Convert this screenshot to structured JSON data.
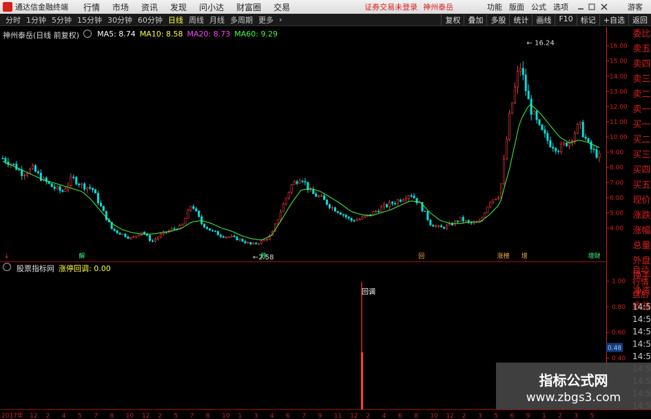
{
  "menubar": {
    "app_title": "通达信金融终端",
    "menus": [
      "行情",
      "市场",
      "资讯",
      "发现",
      "问小达",
      "财富圈",
      "交易"
    ],
    "notice": "证券交易未登录",
    "stock_notice": "神州泰岳",
    "right_menus": [
      "功能",
      "版面",
      "公式",
      "选项"
    ],
    "guest": "游客"
  },
  "periodbar": {
    "periods": [
      "分时",
      "1分钟",
      "5分钟",
      "15分钟",
      "30分钟",
      "60分钟",
      "日线",
      "周线",
      "月线",
      "多周期",
      "更多"
    ],
    "active": "日线",
    "tools": [
      "复权",
      "叠加",
      "多股",
      "统计",
      "画线",
      "F10",
      "标记",
      "+自选",
      "返回"
    ]
  },
  "main_legend": {
    "title": "神州泰岳(日线 前复权)",
    "ma5": "MA5: 8.74",
    "ma10": "MA10: 8.58",
    "ma20": "MA20: 8.73",
    "ma60": "MA60: 9.29"
  },
  "sub_legend": {
    "title": "股票指标网",
    "indicator": "涨停回调: 0.00"
  },
  "colors": {
    "up": "#ff3c3c",
    "down": "#00e0e0",
    "ma5": "#ffffff",
    "ma10": "#ffff3c",
    "ma20": "#ff40ff",
    "ma60": "#40ff40",
    "axis": "#d8201c",
    "indicator_bar": "#ff4020"
  },
  "right_panel": {
    "labels": [
      "委比",
      "卖五",
      "卖四",
      "卖三",
      "卖二",
      "卖一",
      "买一",
      "买二",
      "买三",
      "买四",
      "买五",
      "现价",
      "涨跌",
      "涨幅",
      "总量",
      "外盘",
      "换手",
      "净资",
      "收益"
    ],
    "lower_labels": [
      "自动",
      "行情",
      "盘后"
    ],
    "times": [
      "14:56",
      "14:56",
      "14:56",
      "14:56",
      "14:56",
      "14:56",
      "14:56",
      "14:56",
      "14:56"
    ]
  },
  "chart_data": [
    {
      "type": "candlestick",
      "ylim": [
        2.3,
        16.8
      ],
      "yticks": [
        4.0,
        5.0,
        6.0,
        7.0,
        8.0,
        9.0,
        10.0,
        11.0,
        12.0,
        13.0,
        14.0,
        15.0,
        16.0
      ],
      "annotations": [
        {
          "label": "16.24",
          "value": 16.24
        },
        {
          "label": "2.58",
          "value": 2.58
        }
      ],
      "markers": [
        "解",
        "跌",
        "回",
        "涨榜",
        "增",
        "增财"
      ],
      "close_path": [
        8.6,
        8.2,
        7.6,
        7.9,
        7.2,
        6.7,
        6.4,
        7.3,
        6.8,
        6.6,
        5.2,
        3.9,
        3.6,
        3.3,
        3.8,
        3.1,
        3.6,
        3.9,
        4.1,
        5.6,
        4.3,
        3.8,
        3.5,
        3.4,
        3.2,
        2.9,
        3.1,
        3.5,
        5.2,
        6.8,
        7.4,
        6.3,
        6.0,
        5.4,
        5.0,
        4.5,
        4.6,
        4.9,
        5.3,
        5.6,
        5.9,
        6.3,
        5.5,
        4.3,
        4.0,
        4.2,
        4.6,
        4.3,
        4.4,
        5.8,
        6.2,
        11.5,
        14.8,
        12.0,
        10.5,
        9.6,
        9.2,
        9.8,
        10.8,
        9.3,
        8.7
      ],
      "ma_path": [
        8.4,
        8.1,
        7.8,
        7.5,
        7.2,
        7.0,
        6.8,
        6.6,
        6.4,
        5.8,
        5.0,
        4.3,
        3.9,
        3.7,
        3.6,
        3.6,
        3.7,
        3.8,
        4.0,
        4.4,
        4.5,
        4.3,
        4.0,
        3.8,
        3.5,
        3.3,
        3.2,
        3.5,
        4.5,
        5.6,
        6.5,
        6.6,
        6.4,
        6.0,
        5.6,
        5.1,
        4.9,
        4.8,
        5.0,
        5.2,
        5.5,
        5.8,
        5.7,
        5.0,
        4.5,
        4.3,
        4.3,
        4.4,
        4.4,
        4.9,
        5.6,
        8.0,
        11.0,
        12.2,
        11.6,
        10.8,
        10.0,
        9.6,
        9.8,
        9.6,
        9.3
      ]
    },
    {
      "type": "bar",
      "ylim": [
        0.0,
        1.1
      ],
      "yticks": [
        0.4,
        0.6,
        0.8,
        1.0
      ],
      "current_value": "0.48",
      "label": "回调",
      "spike_value": 1.0
    }
  ],
  "date_axis": [
    "2017年",
    "12",
    "2",
    "4",
    "5",
    "7",
    "8",
    "10",
    "12",
    "2",
    "5",
    "7",
    "8",
    "10",
    "1",
    "3",
    "4",
    "6",
    "7",
    "9",
    "11",
    "12",
    "2",
    "4",
    "6",
    "8",
    "10",
    "12",
    "2",
    "3",
    "5",
    "6",
    "9",
    "1",
    "2",
    "3",
    "5"
  ]
}
